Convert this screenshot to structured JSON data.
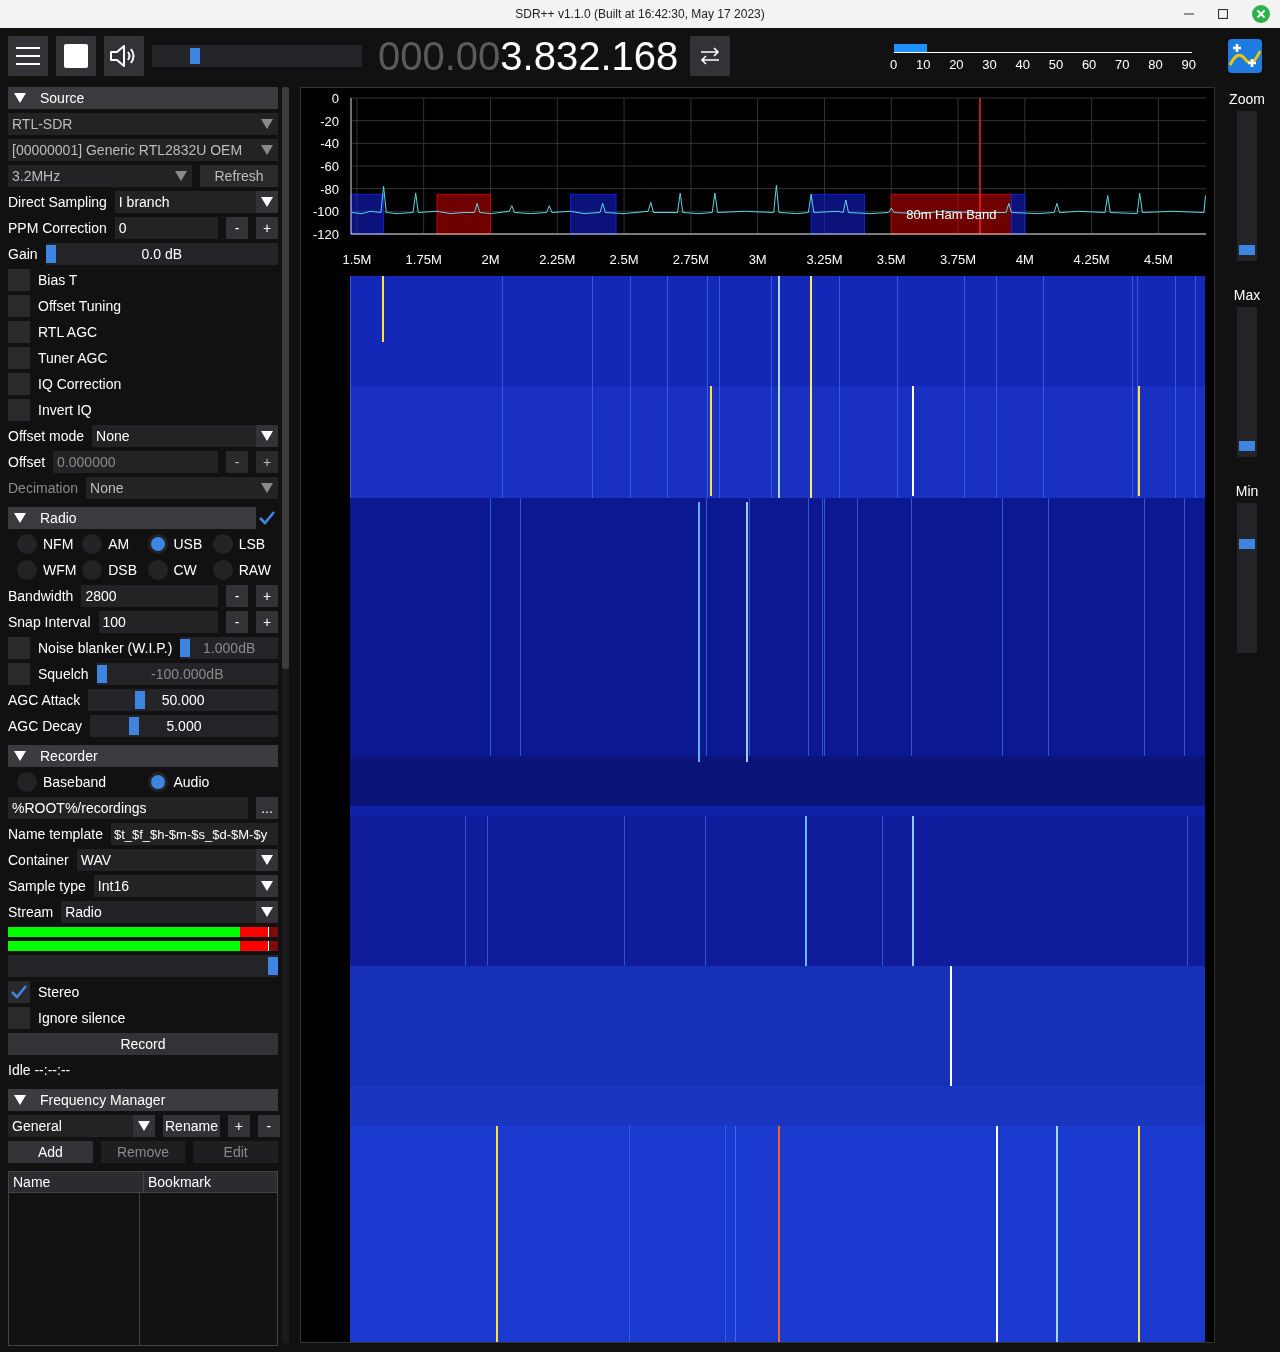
{
  "window": {
    "title": "SDR++ v1.1.0 (Built at 16:42:30, May 17 2023)"
  },
  "toolbar": {
    "playing": true,
    "volume": {
      "level": 0.19
    },
    "frequency_dim": "000.00",
    "frequency": "3.832.168",
    "snr_meter": {
      "level": 0.11,
      "ticks": [
        "0",
        "10",
        "20",
        "30",
        "40",
        "50",
        "60",
        "70",
        "80",
        "90"
      ]
    }
  },
  "sections": [
    {
      "title": "Source",
      "expanded": true,
      "rows": [
        {
          "kind": "dropdown",
          "value": "RTL-SDR",
          "disabled": true
        },
        {
          "kind": "dropdown",
          "value": "[00000001] Generic RTL2832U OEM",
          "disabled": true
        },
        {
          "kind": "dropdown_button",
          "value": "3.2MHz",
          "button": "Refresh",
          "disabled": true
        },
        {
          "kind": "labeled_dropdown",
          "label": "Direct Sampling",
          "value": "I branch",
          "disabled": false
        },
        {
          "kind": "stepper",
          "label": "PPM Correction",
          "value": "0",
          "buttons": [
            "-",
            "+"
          ],
          "disabled": false
        },
        {
          "kind": "slider",
          "label": "Gain",
          "value": "0.0 dB",
          "level": 0.0
        },
        {
          "kind": "checkbox",
          "label": "Bias T",
          "checked": false
        },
        {
          "kind": "checkbox",
          "label": "Offset Tuning",
          "checked": false
        },
        {
          "kind": "checkbox",
          "label": "RTL AGC",
          "checked": false
        },
        {
          "kind": "checkbox",
          "label": "Tuner AGC",
          "checked": false
        },
        {
          "kind": "checkbox",
          "label": "IQ Correction",
          "checked": false
        },
        {
          "kind": "checkbox",
          "label": "Invert IQ",
          "checked": false
        },
        {
          "kind": "labeled_dropdown",
          "label": "Offset mode",
          "value": "None",
          "disabled": false
        },
        {
          "kind": "stepper",
          "label": "Offset",
          "value": "0.000000",
          "buttons": [
            "-",
            "+"
          ],
          "disabled": true
        },
        {
          "kind": "labeled_dropdown",
          "label": "Decimation",
          "value": "None",
          "disabled": true
        }
      ]
    },
    {
      "title": "Radio",
      "expanded": true,
      "enabled": true,
      "rows": [
        {
          "kind": "radios",
          "options": [
            {
              "label": "NFM",
              "selected": false
            },
            {
              "label": "AM",
              "selected": false
            },
            {
              "label": "USB",
              "selected": true
            },
            {
              "label": "LSB",
              "selected": false
            },
            {
              "label": "WFM",
              "selected": false
            },
            {
              "label": "DSB",
              "selected": false
            },
            {
              "label": "CW",
              "selected": false
            },
            {
              "label": "RAW",
              "selected": false
            }
          ]
        },
        {
          "kind": "stepper",
          "label": "Bandwidth",
          "value": "2800",
          "buttons": [
            "-",
            "+"
          ],
          "disabled": false
        },
        {
          "kind": "stepper",
          "label": "Snap Interval",
          "value": "100",
          "buttons": [
            "-",
            "+"
          ],
          "disabled": false
        },
        {
          "kind": "check_slider",
          "label": "Noise blanker (W.I.P.)",
          "checked": false,
          "value": "1.000dB",
          "level": 0.0
        },
        {
          "kind": "check_slider",
          "label": "Squelch",
          "checked": false,
          "value": "-100.000dB",
          "level": 0.0
        },
        {
          "kind": "slider",
          "label": "AGC Attack",
          "value": "50.000",
          "level": 0.26
        },
        {
          "kind": "slider",
          "label": "AGC Decay",
          "value": "5.000",
          "level": 0.22
        }
      ]
    },
    {
      "title": "Recorder",
      "expanded": true,
      "rows": [
        {
          "kind": "radios",
          "options": [
            {
              "label": "Baseband",
              "selected": false
            },
            {
              "label": "Audio",
              "selected": true
            }
          ]
        },
        {
          "kind": "path",
          "value": "%ROOT%/recordings",
          "button": "..."
        },
        {
          "kind": "labeled_input",
          "label": "Name template",
          "value": "$t_$f_$h-$m-$s_$d-$M-$y"
        },
        {
          "kind": "labeled_dropdown",
          "label": "Container",
          "value": "WAV",
          "disabled": false
        },
        {
          "kind": "labeled_dropdown",
          "label": "Sample type",
          "value": "Int16",
          "disabled": false
        },
        {
          "kind": "labeled_dropdown",
          "label": "Stream",
          "value": "Radio",
          "disabled": false
        },
        {
          "kind": "meter",
          "level": 0.965
        },
        {
          "kind": "meter",
          "level": 0.965
        },
        {
          "kind": "bare_slider",
          "level": 1.0
        },
        {
          "kind": "checkbox",
          "label": "Stereo",
          "checked": true
        },
        {
          "kind": "checkbox",
          "label": "Ignore silence",
          "checked": false
        },
        {
          "kind": "button",
          "label": "Record"
        },
        {
          "kind": "text",
          "text": "Idle --:--:--"
        }
      ]
    },
    {
      "title": "Frequency Manager",
      "expanded": true,
      "rows": [
        {
          "kind": "list_select",
          "value": "General",
          "buttons": [
            "Rename",
            "+",
            "-"
          ]
        },
        {
          "kind": "buttons",
          "buttons": [
            {
              "label": "Add",
              "disabled": false
            },
            {
              "label": "Remove",
              "disabled": true
            },
            {
              "label": "Edit",
              "disabled": true
            }
          ]
        },
        {
          "kind": "table",
          "columns": [
            "Name",
            "Bookmark"
          ]
        }
      ]
    }
  ],
  "spectrum": {
    "chart_data": {
      "type": "line",
      "grid": true,
      "xlim": [
        1.478,
        4.678
      ],
      "ylim": [
        -120,
        0
      ],
      "yticks": [
        0,
        -20,
        -40,
        -60,
        -80,
        -100,
        -120
      ],
      "xticks": [
        {
          "value": 1.5,
          "label": "1.5M"
        },
        {
          "value": 1.75,
          "label": "1.75M"
        },
        {
          "value": 2,
          "label": "2M"
        },
        {
          "value": 2.25,
          "label": "2.25M"
        },
        {
          "value": 2.5,
          "label": "2.5M"
        },
        {
          "value": 2.75,
          "label": "2.75M"
        },
        {
          "value": 3,
          "label": "3M"
        },
        {
          "value": 3.25,
          "label": "3.25M"
        },
        {
          "value": 3.5,
          "label": "3.5M"
        },
        {
          "value": 3.75,
          "label": "3.75M"
        },
        {
          "value": 4,
          "label": "4M"
        },
        {
          "value": 4.25,
          "label": "4.25M"
        },
        {
          "value": 4.5,
          "label": "4.5M"
        }
      ],
      "x": [
        1.48,
        1.52,
        1.55,
        1.59,
        1.6,
        1.61,
        1.65,
        1.71,
        1.72,
        1.73,
        1.8,
        1.85,
        1.9,
        1.94,
        1.95,
        1.96,
        2.0,
        2.07,
        2.08,
        2.09,
        2.15,
        2.21,
        2.22,
        2.23,
        2.3,
        2.35,
        2.41,
        2.42,
        2.43,
        2.5,
        2.59,
        2.6,
        2.61,
        2.7,
        2.71,
        2.72,
        2.78,
        2.83,
        2.84,
        2.85,
        2.95,
        3.06,
        3.07,
        3.08,
        3.15,
        3.19,
        3.2,
        3.21,
        3.3,
        3.32,
        3.33,
        3.34,
        3.42,
        3.49,
        3.5,
        3.51,
        3.6,
        3.7,
        3.8,
        3.93,
        3.94,
        3.95,
        4.05,
        4.11,
        4.12,
        4.13,
        4.2,
        4.3,
        4.31,
        4.32,
        4.42,
        4.43,
        4.44,
        4.55,
        4.67,
        4.676
      ],
      "series": [
        {
          "color": "#5fd6e0",
          "values": [
            -101,
            -102,
            -100,
            -101,
            -78,
            -101,
            -102,
            -101,
            -84,
            -101,
            -100,
            -102,
            -101,
            -101,
            -93,
            -101,
            -102,
            -100,
            -95,
            -101,
            -102,
            -101,
            -95,
            -101,
            -100,
            -102,
            -101,
            -93,
            -101,
            -102,
            -100,
            -92,
            -101,
            -101,
            -84,
            -101,
            -102,
            -101,
            -84,
            -101,
            -100,
            -101,
            -77,
            -101,
            -102,
            -101,
            -85,
            -101,
            -100,
            -101,
            -90,
            -101,
            -102,
            -101,
            -97,
            -101,
            -102,
            -100,
            -101,
            -101,
            -93,
            -101,
            -102,
            -101,
            -93,
            -101,
            -100,
            -101,
            -86,
            -101,
            -102,
            -84,
            -101,
            -100,
            -101,
            -86
          ]
        }
      ],
      "bands": [
        {
          "axis": "x",
          "from": 1.478,
          "to": 1.6,
          "color": "#1420dc"
        },
        {
          "axis": "x",
          "from": 1.8,
          "to": 2.0,
          "color": "#c80000"
        },
        {
          "axis": "x",
          "from": 2.3,
          "to": 2.47,
          "color": "#1420dc"
        },
        {
          "axis": "x",
          "from": 3.2,
          "to": 3.4,
          "color": "#1420dc"
        },
        {
          "axis": "x",
          "from": 3.5,
          "to": 3.95,
          "color": "#c80000",
          "label": "80m Ham Band"
        },
        {
          "axis": "x",
          "from": 3.95,
          "to": 4.0,
          "color": "#1420dc"
        }
      ],
      "ref_lines": [
        {
          "axis": "x",
          "value": 3.832,
          "color": "#ff2020"
        }
      ]
    }
  },
  "side_sliders": [
    {
      "label": "Zoom",
      "level": 0.04
    },
    {
      "label": "Max",
      "level": 0.04
    },
    {
      "label": "Min",
      "level": 0.74
    }
  ]
}
